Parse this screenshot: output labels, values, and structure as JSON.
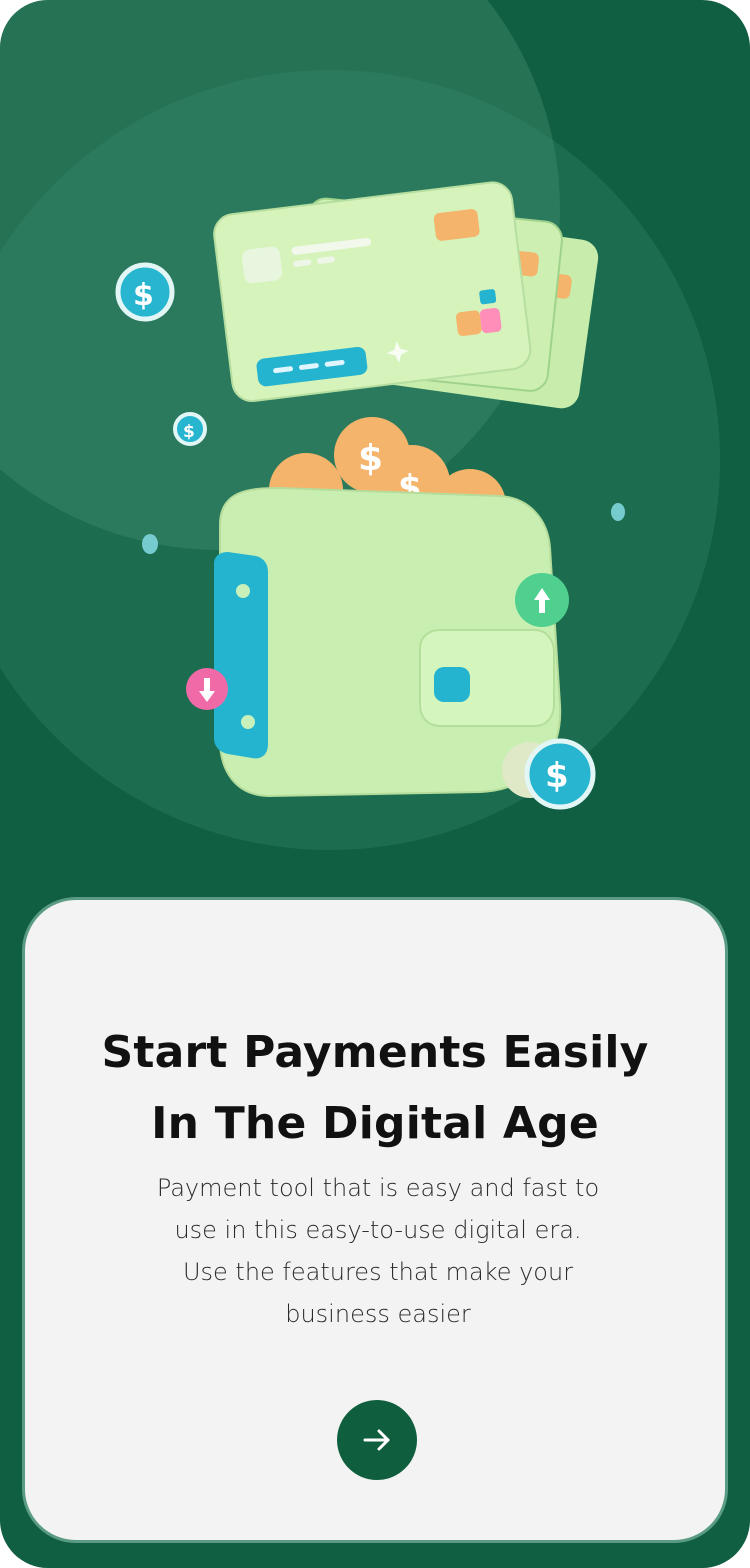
{
  "onboarding": {
    "title_line1": "Start Payments Easily",
    "title_line2": "In The Digital Age",
    "description_lines": [
      "Payment tool that is easy and fast to",
      "use in this easy-to-use digital era.",
      "Use the features that make your",
      "business easier"
    ],
    "next_icon": "arrow-right-icon"
  },
  "colors": {
    "background": "#115f42",
    "card": "#f3f3f3",
    "accent": "#0f5f3e",
    "wallet": "#cfeeb8",
    "wallet_strap": "#2bb3d3",
    "coin": "#f4b46b",
    "arrow_up": "#4fd08f",
    "arrow_down": "#f06aa8"
  }
}
